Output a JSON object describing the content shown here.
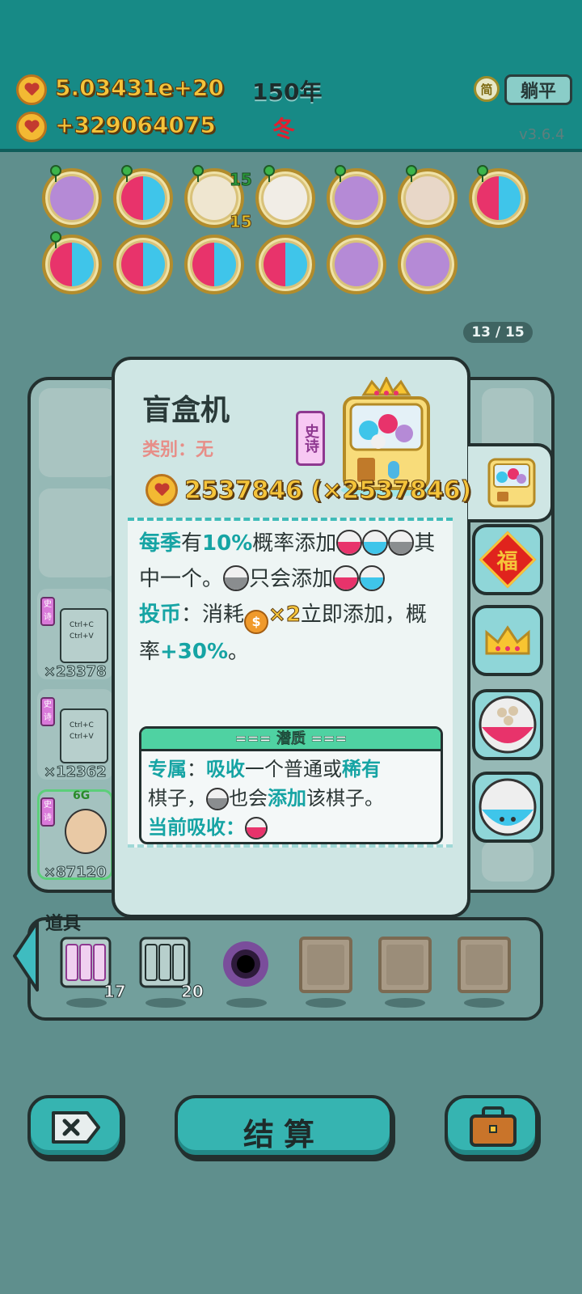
{
  "header": {
    "gold_total": "5.03431e+20",
    "gold_income": "+329064075",
    "year": "150年",
    "season": "冬",
    "simple_icon": "简",
    "lie_flat_label": "躺平",
    "version": "v3.6.4"
  },
  "relics": {
    "shell_count_top": "15",
    "shell_count_bottom": "15",
    "pager": "13 / 15"
  },
  "board": {
    "card1_mult": "×23378",
    "card2_mult": "×12362",
    "card3_mult": "×87120",
    "card3_level": "6G",
    "ctrl_c": "Ctrl+C",
    "ctrl_v": "Ctrl+V",
    "epic_short": "史诗"
  },
  "popup": {
    "title": "盲盒机",
    "category": "类别：无",
    "rarity": "史诗",
    "value": "2537846 (×2537846)",
    "desc": {
      "p1_a": "每季",
      "p1_b": "有",
      "p1_c": "10%",
      "p1_d": "概率添加",
      "p1_e": "其中一个。",
      "p1_f": "只会添加",
      "p2_a": "投币",
      "p2_b": "：消耗",
      "p2_c": "×2",
      "p2_d": "立即添加，概率",
      "p2_e": "+30%",
      "p2_f": "。"
    },
    "potential": {
      "header": "=== 潜质 ===",
      "l1_a": "专属",
      "l1_b": "：",
      "l1_c": "吸收",
      "l1_d": "一个普通或",
      "l1_e": "稀有",
      "l2_a": "棋子，",
      "l2_b": "也会",
      "l2_c": "添加",
      "l2_d": "该棋子。",
      "l3_a": "当前吸收："
    },
    "fu_char": "福"
  },
  "tools": {
    "label": "道具",
    "slot1_count": "17",
    "slot2_count": "20"
  },
  "buttons": {
    "settle": "结算"
  },
  "colors": {
    "header_bg": "#178a86",
    "accent_teal": "#16a4a4",
    "gold_text": "#f5c43a",
    "season_red": "#e21f2f",
    "epic_purple": "#8e3890"
  }
}
